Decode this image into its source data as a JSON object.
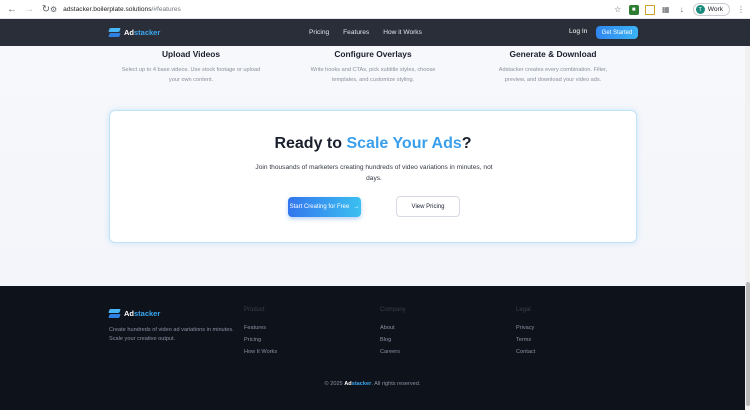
{
  "browser": {
    "url_domain": "adstacker.boilerplate.solutions",
    "url_path": "/#features",
    "profile_label": "Work",
    "profile_initial": "T",
    "icons": [
      "back-icon",
      "forward-icon",
      "reload-icon",
      "site-settings-icon",
      "star-icon",
      "extension-icon",
      "puzzle-icon",
      "download-icon",
      "menu-icon"
    ]
  },
  "header": {
    "logo_ad": "Ad",
    "logo_stacker": "stacker",
    "nav": [
      "Pricing",
      "Features",
      "How it Works"
    ],
    "login": "Log In",
    "get_started": "Get Started"
  },
  "features": [
    {
      "title": "Upload Videos",
      "desc": "Select up to 4 base videos. Use stock footage or upload your own content."
    },
    {
      "title": "Configure Overlays",
      "desc": "Write hooks and CTAs, pick subtitle styles, choose templates, and customize styling."
    },
    {
      "title": "Generate & Download",
      "desc": "Adstacker creates every combination. Filter, preview, and download your video ads."
    }
  ],
  "cta": {
    "title_prefix": "Ready to",
    "title_highlight": "Scale Your Ads",
    "title_suffix": "?",
    "subtitle": "Join thousands of marketers creating hundreds of video variations in minutes, not days.",
    "primary_label": "Start Creating for Free",
    "primary_arrow": "→",
    "secondary_label": "View Pricing"
  },
  "footer": {
    "logo_ad": "Ad",
    "logo_stacker": "stacker",
    "tagline": "Create hundreds of video ad variations in minutes. Scale your creative output.",
    "columns": [
      {
        "heading": "Product",
        "links": [
          "Features",
          "Pricing",
          "How It Works"
        ]
      },
      {
        "heading": "Company",
        "links": [
          "About",
          "Blog",
          "Careers"
        ]
      },
      {
        "heading": "Legal",
        "links": [
          "Privacy",
          "Terms",
          "Contact"
        ]
      }
    ],
    "copyright_prefix": "© 2025",
    "copyright_ad": "Ad",
    "copyright_stacker": "stacker",
    "copyright_suffix": ". All rights reserved."
  },
  "colors": {
    "accent": "#3ba7f0",
    "header_bg": "#2a2e38",
    "footer_bg": "#0d121b"
  }
}
